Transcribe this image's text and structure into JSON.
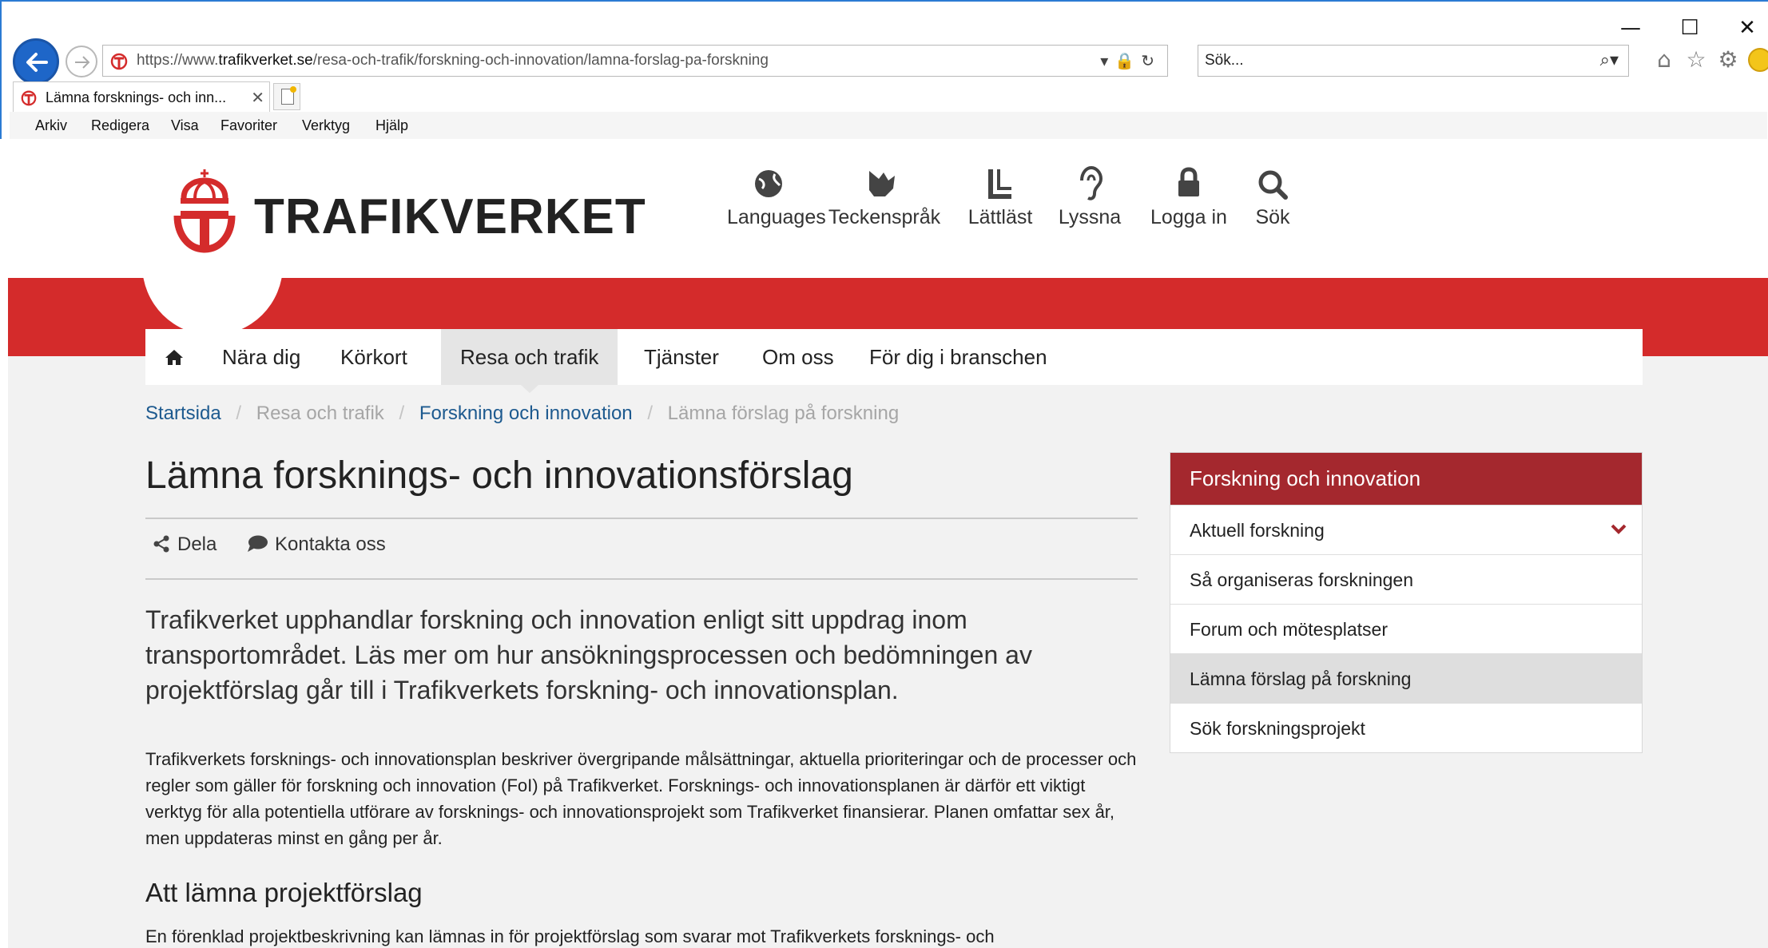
{
  "browser": {
    "window_controls": {
      "minimize": "—",
      "maximize": "☐",
      "close": "✕"
    },
    "address": {
      "url_prefix": "https://www.",
      "url_domain": "trafikverket.se",
      "url_path": "/resa-och-trafik/forskning-och-innovation/lamna-forslag-pa-forskning",
      "tools": "▾🔒↻"
    },
    "search": {
      "placeholder": "Sök...",
      "icon": "⌕▾"
    },
    "tab": {
      "title": "Lämna forsknings- och inn...",
      "close": "✕"
    },
    "menu": [
      "Arkiv",
      "Redigera",
      "Visa",
      "Favoriter",
      "Verktyg",
      "Hjälp"
    ],
    "command_icons": {
      "home": "⌂",
      "favorites": "☆",
      "settings": "⚙"
    }
  },
  "site": {
    "logo_text": "TRAFIKVERKET",
    "utility_nav": [
      "Languages",
      "Teckenspråk",
      "Lättläst",
      "Lyssna",
      "Logga in",
      "Sök"
    ],
    "main_nav": [
      "Nära dig",
      "Körkort",
      "Resa och trafik",
      "Tjänster",
      "Om oss",
      "För dig i branschen"
    ],
    "main_nav_active": "Resa och trafik",
    "home_icon": "⌂",
    "breadcrumb": {
      "home": "Startsida",
      "level1": "Resa och trafik",
      "level2": "Forskning och innovation",
      "current": "Lämna förslag på forskning",
      "separator": "/"
    },
    "colors": {
      "brand_red": "#d42b2b",
      "menu_head": "#a4282e",
      "link": "#1d5a8f"
    }
  },
  "content": {
    "title": "Lämna forsknings- och innovationsförslag",
    "share_label": "Dela",
    "contact_label": "Kontakta oss",
    "lead": "Trafikverket upphandlar forskning och innovation enligt sitt uppdrag inom transportområdet. Läs mer om hur ansökningsprocessen och bedömningen av projektförslag går till i Trafikverkets forskning- och innovationsplan.",
    "body1": "Trafikverkets forsknings- och innovationsplan beskriver övergripande målsättningar, aktuella prioriteringar och de processer och regler som gäller för forskning och innovation (FoI) på Trafikverket. Forsknings- och innovationsplanen är därför ett viktigt verktyg för alla potentiella utförare av forsknings- och innovationsprojekt som Trafikverket finansierar. Planen omfattar sex år, men uppdateras minst en gång per år.",
    "h2": "Att lämna projektförslag",
    "body2": "En förenklad projektbeskrivning kan lämnas in för projektförslag som svarar mot Trafikverkets forsknings- och"
  },
  "sidebar": {
    "title": "Forskning och innovation",
    "items": [
      "Aktuell forskning",
      "Så organiseras forskningen",
      "Forum och mötesplatser",
      "Lämna förslag på forskning",
      "Sök forskningsprojekt"
    ],
    "selected": "Lämna förslag på forskning"
  }
}
